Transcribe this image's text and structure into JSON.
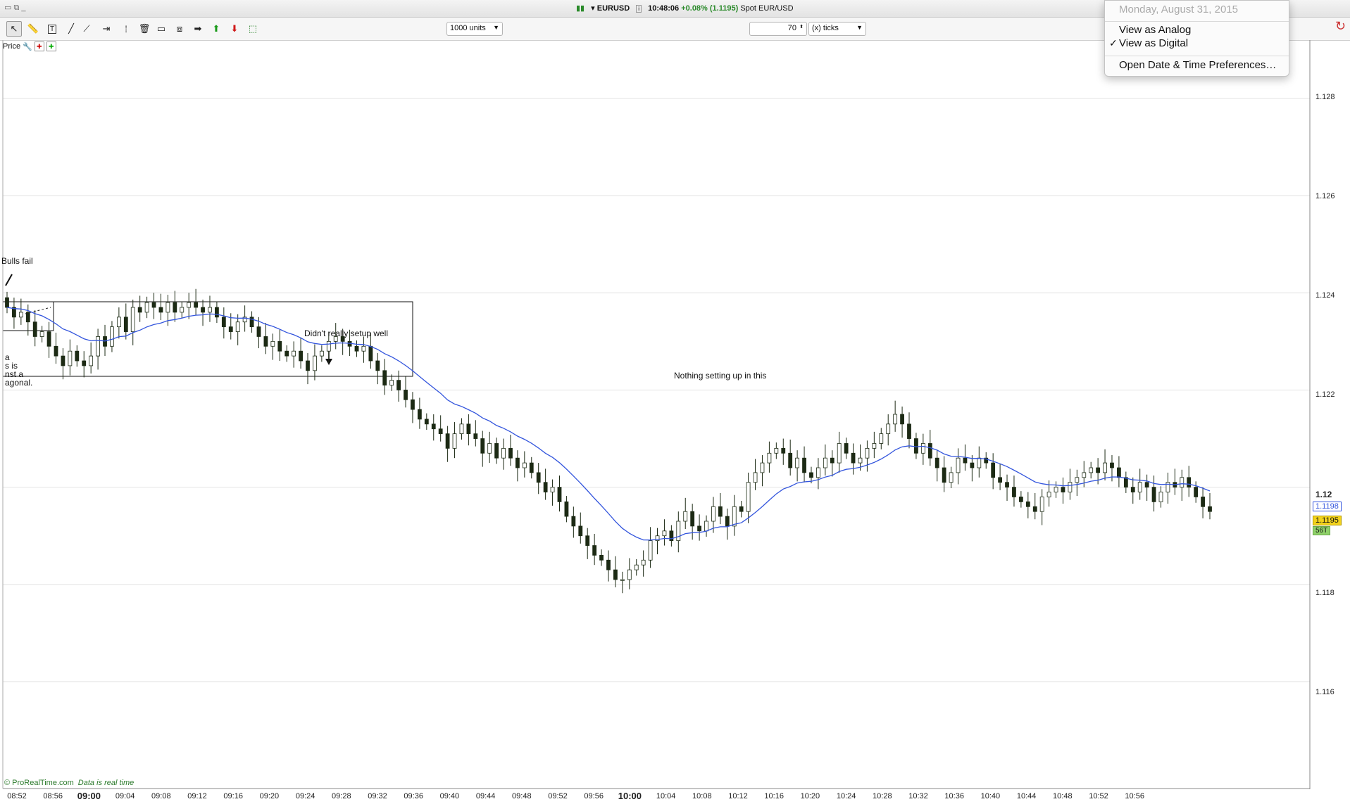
{
  "titlebar": {
    "symbol": "EURUSD",
    "time": "10:48:06",
    "change": "+0.08% (1.1195)",
    "instrument": "Spot EUR/USD"
  },
  "toolbar": {
    "tools": [
      "cursor-tool",
      "ruler-tool",
      "text-tool",
      "line-tool",
      "ray-tool",
      "horizontal-line-tool",
      "vertical-line-tool",
      "delete-tool",
      "rectangle-tool",
      "channel-tool",
      "arrow-right-tool",
      "arrow-up-tool",
      "arrow-down-tool",
      "zoom-chart-tool"
    ],
    "units_select": "1000 units",
    "ticks_value": "70",
    "ticks_select": "(x) ticks"
  },
  "price_panel": {
    "label": "Price"
  },
  "menu": {
    "header": "Monday, August 31, 2015",
    "items": [
      {
        "label": "View as Analog",
        "checked": false
      },
      {
        "label": "View as Digital",
        "checked": true
      },
      {
        "label": "Open Date & Time Preferences…",
        "checked": false
      }
    ]
  },
  "annotations": {
    "bulls_fail": "Bulls fail",
    "didnt_setup": "Didn't really setup well",
    "nothing_setting": "Nothing setting up in this",
    "left_text": [
      "a",
      "s is",
      "nst a",
      "agonal."
    ]
  },
  "status": {
    "brand": "© ProRealTime.com",
    "realtime": "Data is real time"
  },
  "chart_data": {
    "type": "candlestick",
    "y_axis": {
      "ticks": [
        "1.128",
        "1.126",
        "1.124",
        "1.122",
        "1.12",
        "1.118",
        "1.116"
      ],
      "range": [
        1.1138,
        1.1292
      ]
    },
    "x_axis": {
      "ticks": [
        "08:52",
        "08:56",
        "09:00",
        "09:04",
        "09:08",
        "09:12",
        "09:16",
        "09:20",
        "09:24",
        "09:28",
        "09:32",
        "09:36",
        "09:40",
        "09:44",
        "09:48",
        "09:52",
        "09:56",
        "10:00",
        "10:04",
        "10:08",
        "10:12",
        "10:16",
        "10:20",
        "10:24",
        "10:28",
        "10:32",
        "10:36",
        "10:40",
        "10:44",
        "10:48",
        "10:52",
        "10:56"
      ],
      "bold": [
        "09:00",
        "10:00"
      ]
    },
    "price_labels": {
      "ma": "1.1198",
      "last": "1.1195",
      "ticks": "56T"
    },
    "colors": {
      "bull": "#ffffff",
      "bear": "#1c2a14",
      "ma": "#3355dd",
      "last_bg": "#f2d21c",
      "ticks_bg": "#8fd16a"
    },
    "closes": [
      1.1237,
      1.1235,
      1.1236,
      1.1234,
      1.1231,
      1.1232,
      1.1229,
      1.1227,
      1.1225,
      1.1228,
      1.1226,
      1.1225,
      1.1227,
      1.1231,
      1.1229,
      1.1233,
      1.1235,
      1.1232,
      1.1237,
      1.1236,
      1.1238,
      1.1237,
      1.1236,
      1.1238,
      1.1236,
      1.1237,
      1.1238,
      1.1237,
      1.1236,
      1.1237,
      1.1235,
      1.1233,
      1.1232,
      1.1234,
      1.1235,
      1.1233,
      1.1231,
      1.1229,
      1.123,
      1.1228,
      1.1227,
      1.1228,
      1.1226,
      1.1224,
      1.1227,
      1.1228,
      1.123,
      1.1231,
      1.123,
      1.1229,
      1.1228,
      1.1229,
      1.1226,
      1.1224,
      1.1221,
      1.1222,
      1.122,
      1.1218,
      1.1216,
      1.1214,
      1.1213,
      1.1212,
      1.1211,
      1.1208,
      1.1211,
      1.1213,
      1.1211,
      1.121,
      1.1207,
      1.1209,
      1.1206,
      1.1208,
      1.1206,
      1.1204,
      1.1205,
      1.1203,
      1.1201,
      1.1199,
      1.12,
      1.1197,
      1.1194,
      1.1192,
      1.119,
      1.1188,
      1.1186,
      1.1185,
      1.1183,
      1.1181,
      1.1181,
      1.1183,
      1.1184,
      1.1185,
      1.1189,
      1.119,
      1.1191,
      1.1189,
      1.1193,
      1.1195,
      1.1192,
      1.1191,
      1.1193,
      1.1196,
      1.1194,
      1.1192,
      1.1196,
      1.1195,
      1.1201,
      1.1203,
      1.1205,
      1.1207,
      1.1208,
      1.1207,
      1.1204,
      1.1206,
      1.1203,
      1.1202,
      1.1204,
      1.1206,
      1.1205,
      1.1209,
      1.1207,
      1.1205,
      1.1206,
      1.1208,
      1.1209,
      1.1211,
      1.1213,
      1.1215,
      1.1213,
      1.121,
      1.1207,
      1.1209,
      1.1206,
      1.1204,
      1.1201,
      1.1203,
      1.1206,
      1.1205,
      1.1204,
      1.1206,
      1.1205,
      1.1202,
      1.1201,
      1.12,
      1.1198,
      1.1197,
      1.1196,
      1.1195,
      1.1198,
      1.1199,
      1.12,
      1.1199,
      1.1201,
      1.1202,
      1.1203,
      1.1204,
      1.1203,
      1.1205,
      1.1204,
      1.1202,
      1.12,
      1.1199,
      1.1201,
      1.12,
      1.1197,
      1.1199,
      1.1201,
      1.12,
      1.1202,
      1.12,
      1.1198,
      1.1196,
      1.1195
    ],
    "ma_series_name": ""
  }
}
